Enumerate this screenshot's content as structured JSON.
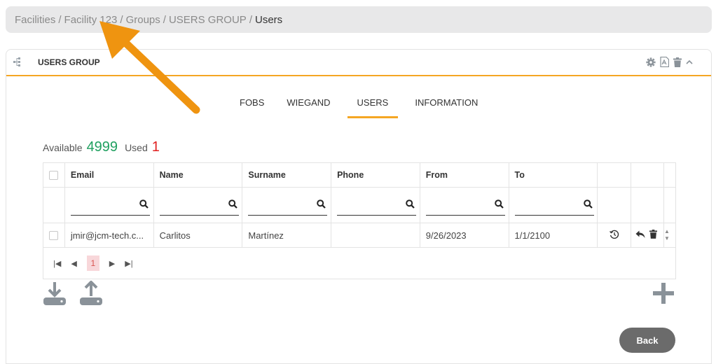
{
  "breadcrumb": {
    "items": [
      "Facilities",
      "Facility 123",
      "Groups",
      "USERS GROUP"
    ],
    "separator": "/",
    "current": "Users"
  },
  "panel": {
    "title": "USERS GROUP"
  },
  "tabs": [
    {
      "label": "FOBS"
    },
    {
      "label": "WIEGAND"
    },
    {
      "label": "USERS",
      "active": true
    },
    {
      "label": "INFORMATION"
    }
  ],
  "counts": {
    "available_label": "Available",
    "available_value": "4999",
    "used_label": "Used",
    "used_value": "1"
  },
  "table": {
    "columns": [
      "Email",
      "Name",
      "Surname",
      "Phone",
      "From",
      "To"
    ],
    "rows": [
      {
        "email": "jmir@jcm-tech.c...",
        "name": "Carlitos",
        "surname": "Martínez",
        "phone": "",
        "from": "9/26/2023",
        "to": "1/1/2100"
      }
    ],
    "pager": {
      "current_page": "1"
    }
  },
  "back_button": {
    "label": "Back"
  },
  "colors": {
    "accent": "#f5a623",
    "available": "#20a060",
    "used": "#e02020",
    "icon_gray": "#8a9299"
  }
}
